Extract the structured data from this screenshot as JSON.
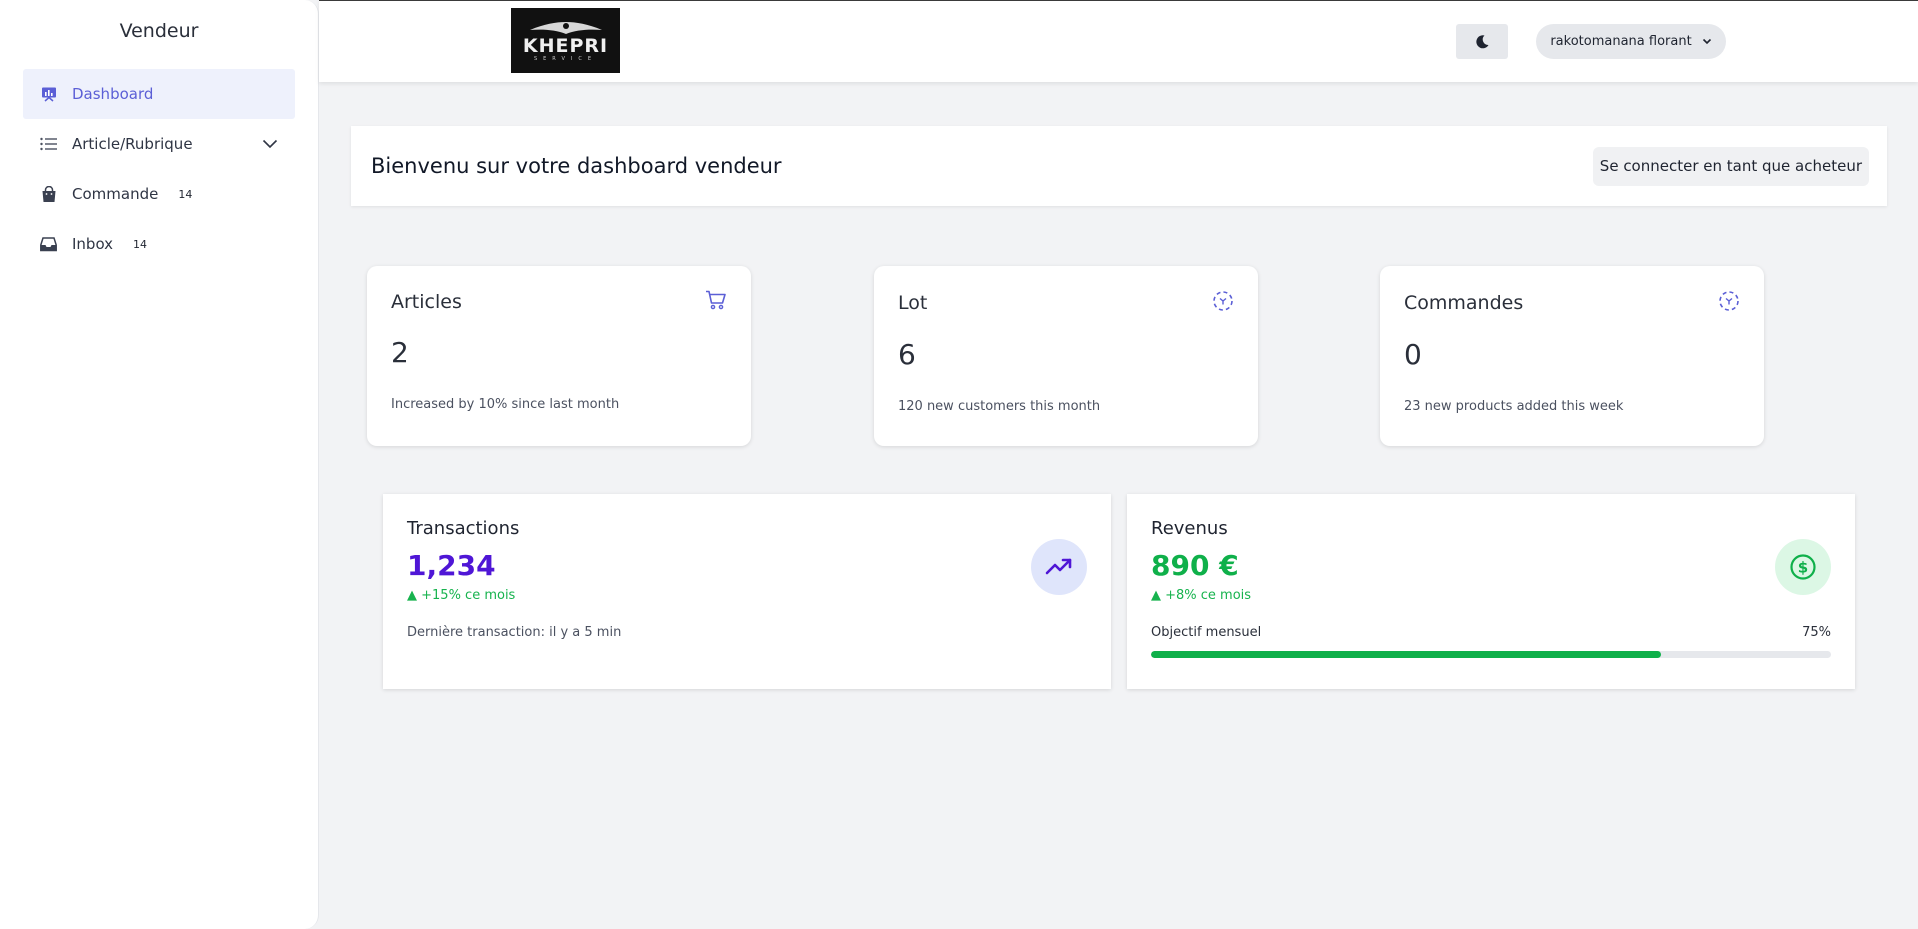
{
  "sidebar": {
    "title": "Vendeur",
    "items": [
      {
        "label": "Dashboard",
        "badge": "",
        "icon": "chart-presentation-icon"
      },
      {
        "label": "Article/Rubrique",
        "badge": "",
        "icon": "list-icon"
      },
      {
        "label": "Commande",
        "badge": "14",
        "icon": "shopping-bag-icon"
      },
      {
        "label": "Inbox",
        "badge": "14",
        "icon": "inbox-icon"
      }
    ]
  },
  "header": {
    "logo_text": "KHEPRI",
    "logo_sub": "SERVICE",
    "user_name": "rakotomanana florant"
  },
  "welcome": {
    "title": "Bienvenu sur votre dashboard vendeur",
    "buyer_button": "Se connecter en tant que acheteur"
  },
  "stats": [
    {
      "label": "Articles",
      "value": "2",
      "note": "Increased by 10% since last month"
    },
    {
      "label": "Lot",
      "value": "6",
      "note": "120 new customers this month"
    },
    {
      "label": "Commandes",
      "value": "0",
      "note": "23 new products added this week"
    }
  ],
  "transactions": {
    "label": "Transactions",
    "value": "1,234",
    "change": "▲ +15% ce mois",
    "footer": "Dernière transaction: il y a 5 min"
  },
  "revenus": {
    "label": "Revenus",
    "value": "890 €",
    "change": "▲ +8% ce mois",
    "objective_label": "Objectif mensuel",
    "objective_percent": "75%",
    "objective_fraction": 0.75
  },
  "colors": {
    "accent": "#5b5fd6",
    "transactions_value": "#4f16d6",
    "revenus_green": "#0fb04a",
    "change_green": "#17b34e"
  }
}
